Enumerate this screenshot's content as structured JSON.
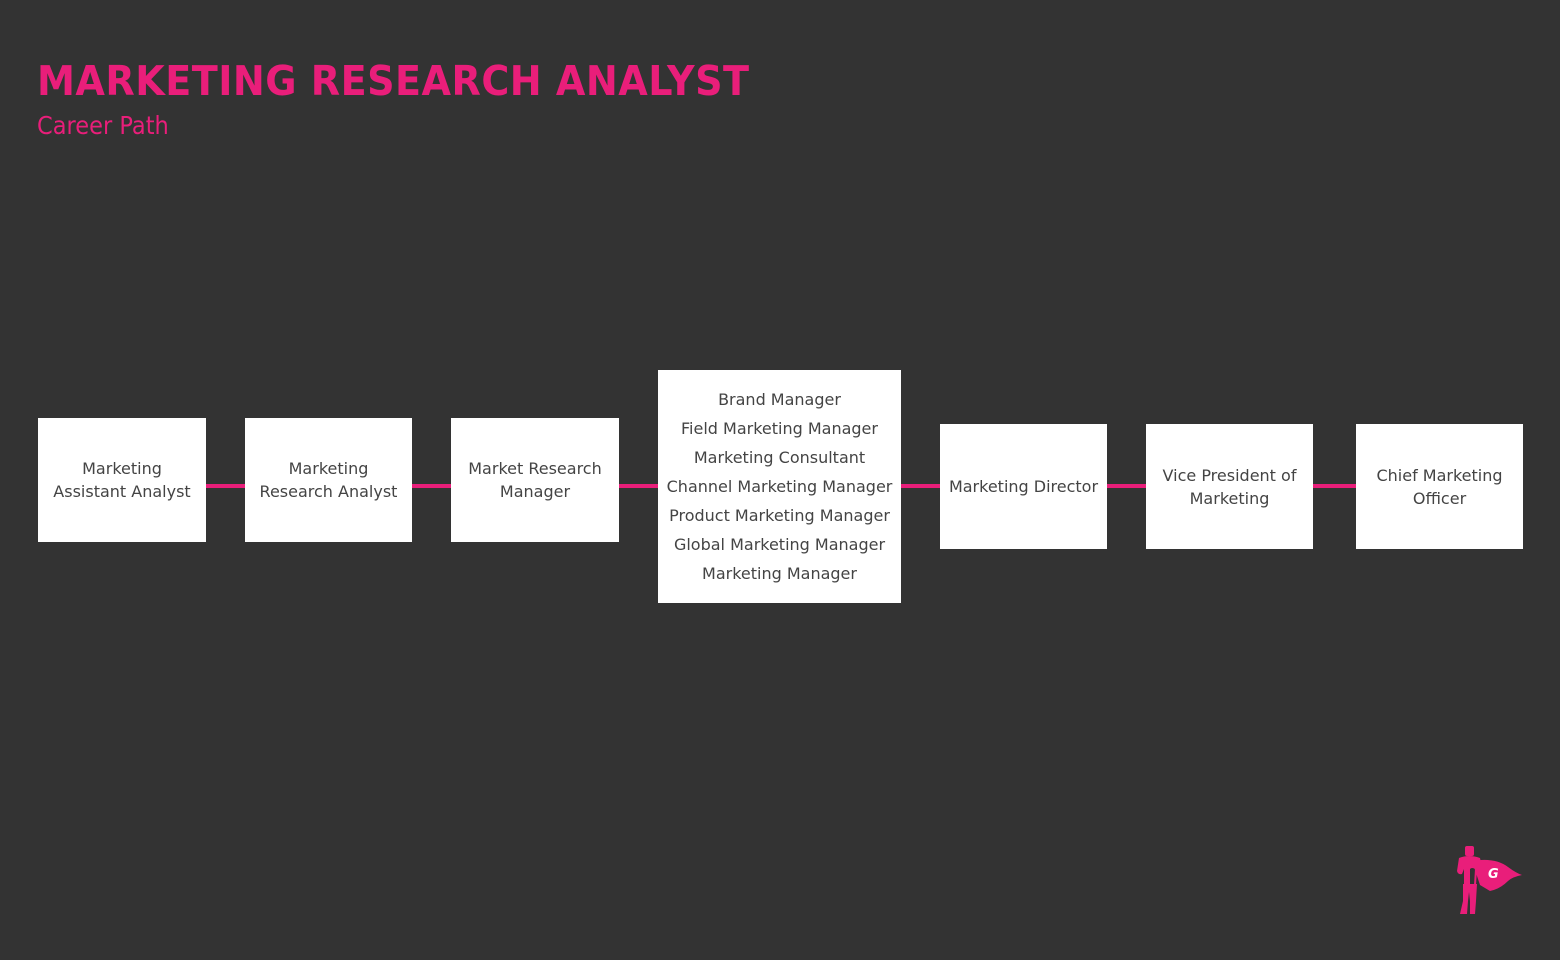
{
  "header": {
    "title": "MARKETING RESEARCH ANALYST",
    "subtitle": "Career Path"
  },
  "colors": {
    "background": "#333333",
    "accent": "#e91e7a",
    "box": "#ffffff",
    "box_text": "#444444"
  },
  "career_path": [
    {
      "lines": [
        "Marketing",
        "Assistant Analyst"
      ]
    },
    {
      "lines": [
        "Marketing",
        "Research Analyst"
      ]
    },
    {
      "lines": [
        "Market Research",
        "Manager"
      ]
    },
    {
      "lines": [
        "Brand Manager",
        "Field Marketing Manager",
        "Marketing Consultant",
        "Channel Marketing Manager",
        "Product Marketing Manager",
        "Global Marketing Manager",
        "Marketing Manager"
      ]
    },
    {
      "lines": [
        "Marketing Director"
      ]
    },
    {
      "lines": [
        "Vice President of",
        "Marketing"
      ]
    },
    {
      "lines": [
        "Chief Marketing",
        "Officer"
      ]
    }
  ],
  "logo": {
    "icon": "superhero-logo-icon",
    "letter": "G"
  }
}
